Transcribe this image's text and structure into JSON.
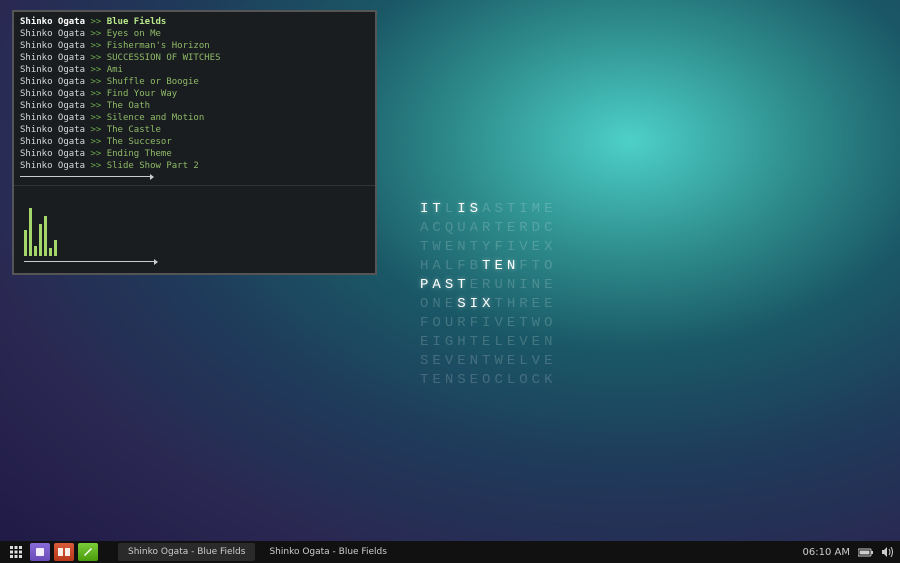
{
  "playlist": {
    "artist": "Shinko Ogata",
    "separator": ">>",
    "current_index": 0,
    "tracks": [
      "Blue Fields",
      "Eyes on Me",
      "Fisherman's Horizon",
      "SUCCESSION OF WITCHES",
      "Ami",
      "Shuffle or Boogie",
      "Find Your Way",
      "The Oath",
      "Silence and Motion",
      "The Castle",
      "The Succesor",
      "Ending Theme",
      "Slide Show Part 2"
    ]
  },
  "visualizer_bars": [
    26,
    48,
    10,
    32,
    40,
    8,
    16
  ],
  "word_clock": {
    "grid": [
      "ITLISASTIME",
      "ACQUARTERDC",
      "TWENTYFIVEX",
      "HALFBTENFTO",
      "PASTERUNINE",
      "ONESIXTHREE",
      "FOURFIVETWO",
      "EIGHTELEVEN",
      "SEVENTWELVE",
      "TENSEOCLOCK"
    ],
    "lit": [
      [
        0,
        0,
        1
      ],
      [
        0,
        3,
        4
      ],
      [
        3,
        5,
        7
      ],
      [
        4,
        0,
        3
      ],
      [
        5,
        3,
        5
      ]
    ]
  },
  "panel": {
    "task1": "Shinko Ogata - Blue Fields",
    "task2": "Shinko Ogata - Blue Fields",
    "clock": "06:10 AM",
    "icons": {
      "apps": "apps",
      "files": "files",
      "dict": "dictionary",
      "editor": "editor"
    }
  }
}
